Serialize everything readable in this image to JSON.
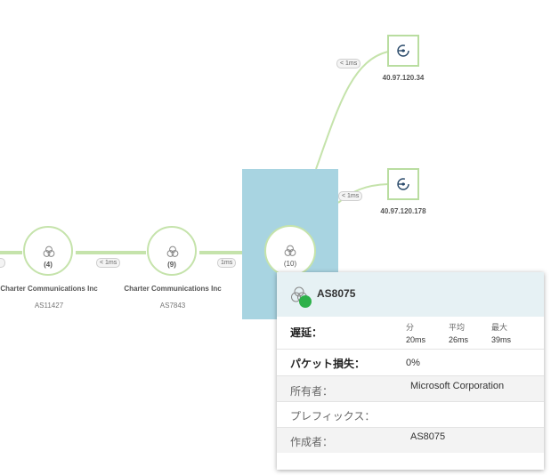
{
  "latency_labels": {
    "top_endpoint": "< 1ms",
    "mid_endpoint": "< 1ms",
    "between_nodes": "< 1ms",
    "to_selected": "1ms"
  },
  "nodes": [
    {
      "name": "Charter Communications Inc",
      "asn": "AS11427",
      "hop": "(4)"
    },
    {
      "name": "Charter Communications Inc",
      "asn": "AS7843",
      "hop": "(9)"
    }
  ],
  "selected_node": {
    "hop": "(10)"
  },
  "endpoints": [
    {
      "ip": "40.97.120.34"
    },
    {
      "ip": "40.97.120.178"
    }
  ],
  "tooltip": {
    "title": "AS8075",
    "status_color": "#2db14a",
    "latency_label": "遅延：",
    "latency_headers": [
      "分",
      "平均",
      "最大"
    ],
    "latency_values": [
      "20ms",
      "26ms",
      "39ms"
    ],
    "packet_loss_label": "パケット損失：",
    "packet_loss_value": "0%",
    "owner_label": "所有者：",
    "owner_value": "Microsoft Corporation",
    "prefix_label": "プレフィックス：",
    "prefix_value": "",
    "creator_label": "作成者：",
    "creator_value": "AS8075"
  },
  "colors": {
    "link": "#c5e3ab",
    "selected_highlight": "#a8d4e1",
    "tooltip_header": "#e6f1f4"
  },
  "icons": [
    "as-cluster-icon",
    "endpoint-target-icon",
    "status-dot-icon"
  ]
}
